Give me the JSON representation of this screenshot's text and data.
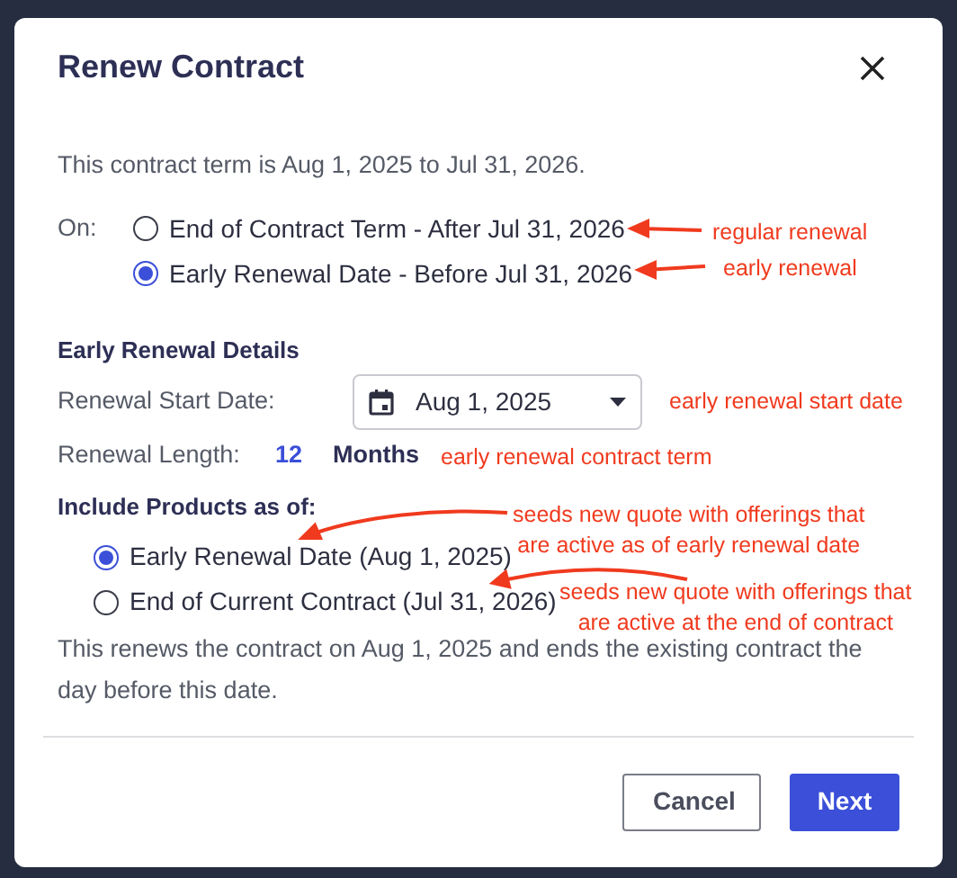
{
  "dialog": {
    "title": "Renew Contract",
    "intro": "This contract term is Aug 1, 2025 to Jul 31, 2026.",
    "on_label": "On:",
    "renewal_options": [
      {
        "label": "End of Contract Term - After Jul 31, 2026",
        "selected": false
      },
      {
        "label": "Early Renewal Date - Before Jul 31, 2026",
        "selected": true
      }
    ],
    "details_heading": "Early Renewal Details",
    "start_date": {
      "label": "Renewal Start Date:",
      "value": "Aug 1, 2025"
    },
    "length": {
      "label": "Renewal Length:",
      "value": "12",
      "unit": "Months"
    },
    "products_heading": "Include Products as of:",
    "product_options": [
      {
        "label": "Early Renewal Date (Aug 1, 2025)",
        "selected": true
      },
      {
        "label": "End of Current Contract (Jul 31, 2026)",
        "selected": false
      }
    ],
    "summary": "This renews the contract on Aug 1, 2025 and ends the existing contract the day before this date.",
    "buttons": [
      {
        "label": "Cancel",
        "kind": "secondary"
      },
      {
        "label": "Next",
        "kind": "primary"
      }
    ]
  },
  "annotations": [
    {
      "lines": [
        "regular renewal"
      ]
    },
    {
      "lines": [
        "early renewal"
      ]
    },
    {
      "lines": [
        "early renewal start date"
      ]
    },
    {
      "lines": [
        "early renewal contract term"
      ]
    },
    {
      "lines": [
        "seeds new quote with offerings that",
        "are active as of early renewal date"
      ]
    },
    {
      "lines": [
        "seeds new quote with offerings that",
        "are active at the end of contract"
      ]
    }
  ]
}
